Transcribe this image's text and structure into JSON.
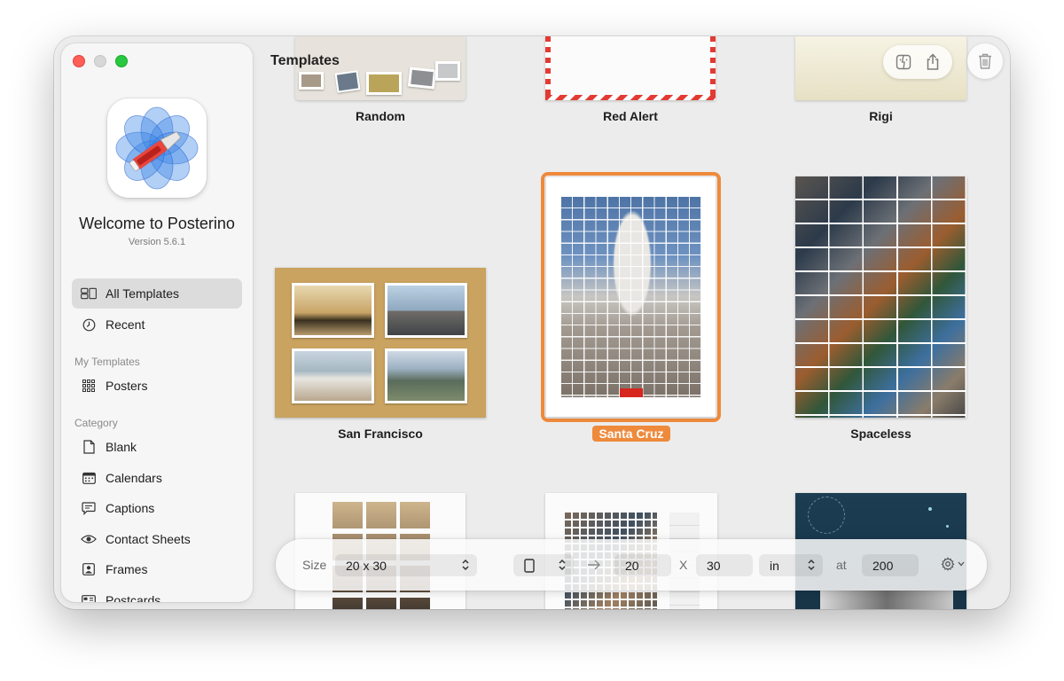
{
  "sidebar": {
    "welcome_title": "Welcome to Posterino",
    "version": "Version 5.6.1",
    "nav": [
      {
        "label": "All Templates",
        "icon": "all-templates-icon",
        "active": true
      },
      {
        "label": "Recent",
        "icon": "clock-icon"
      }
    ],
    "my_templates_header": "My Templates",
    "my_templates": [
      {
        "label": "Posters",
        "icon": "grid-icon"
      }
    ],
    "category_header": "Category",
    "categories": [
      {
        "label": "Blank",
        "icon": "document-icon"
      },
      {
        "label": "Calendars",
        "icon": "calendar-icon"
      },
      {
        "label": "Captions",
        "icon": "speech-bubble-icon"
      },
      {
        "label": "Contact Sheets",
        "icon": "eye-icon"
      },
      {
        "label": "Frames",
        "icon": "person-frame-icon"
      },
      {
        "label": "Postcards",
        "icon": "postcard-icon"
      }
    ]
  },
  "main": {
    "title": "Templates",
    "templates": [
      {
        "name": "Random"
      },
      {
        "name": "Red Alert"
      },
      {
        "name": "Rigi"
      },
      {
        "name": "San Francisco"
      },
      {
        "name": "Santa Cruz",
        "selected": true
      },
      {
        "name": "Spaceless"
      }
    ]
  },
  "bottombar": {
    "size_label": "Size",
    "size_value": "20 x 30",
    "width_value": "20",
    "x_label": "X",
    "height_value": "30",
    "unit_value": "in",
    "at_label": "at",
    "dpi_value": "200"
  },
  "colors": {
    "accent_orange": "#ee8a3c",
    "window_bg": "#ececec",
    "sidebar_bg": "#f6f6f6"
  }
}
